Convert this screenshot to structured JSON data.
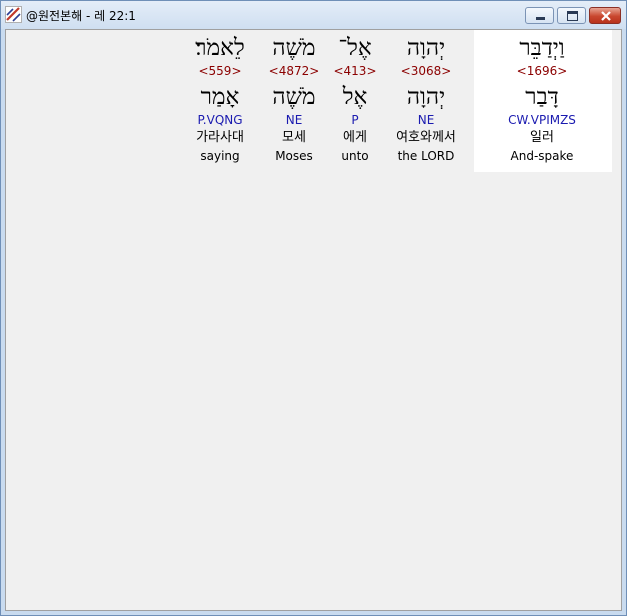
{
  "window": {
    "title": "@원전본해 - 레 22:1",
    "controls": {
      "minimize": "minimize-icon",
      "maximize": "maximize-icon",
      "close": "close-icon"
    }
  },
  "colors": {
    "strong_number": "#8b0000",
    "morphology": "#1b1bb0",
    "highlight_bg": "#ffffff"
  },
  "words": [
    {
      "hebrew": "לֵאמֹר׃",
      "strong": "<559>",
      "lemma": "אָמַר",
      "morph": "P.VQNG",
      "korean": "가라사대",
      "english": "saying"
    },
    {
      "hebrew": "מֹשֶׁה",
      "strong": "<4872>",
      "lemma": "מֹשֶׁה",
      "morph": "NE",
      "korean": "모세",
      "english": "Moses"
    },
    {
      "hebrew": "אֶל־",
      "strong": "<413>",
      "lemma": "אֶל",
      "morph": "P",
      "korean": "에게",
      "english": "unto"
    },
    {
      "hebrew": "יְהוָה",
      "strong": "<3068>",
      "lemma": "יְהוָה",
      "morph": "NE",
      "korean": "여호와께서",
      "english": "the LORD"
    },
    {
      "hebrew": "וַיְדַבֵּר",
      "strong": "<1696>",
      "lemma": "דָּבַר",
      "morph": "CW.VPIMZS",
      "korean": "일러",
      "english": "And-spake"
    }
  ]
}
